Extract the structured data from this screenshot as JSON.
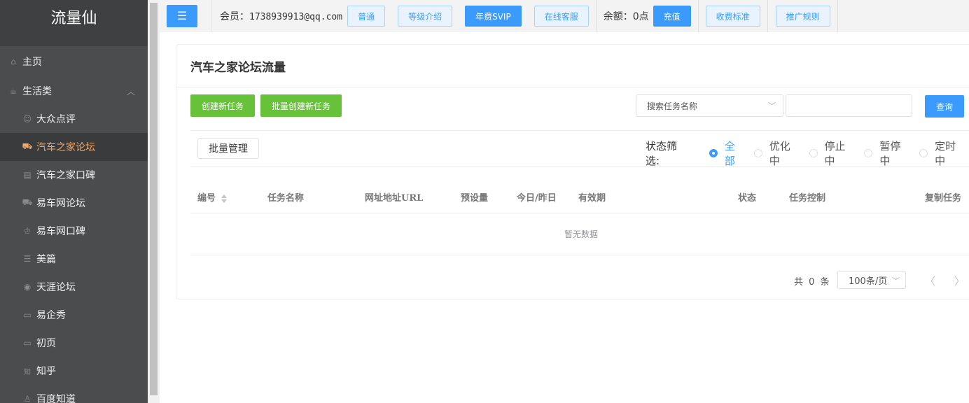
{
  "sidebar": {
    "brand": "流量仙",
    "items": [
      {
        "label": "主页",
        "icon": "home-icon",
        "glyph": "⌂",
        "level": "top"
      },
      {
        "label": "生活类",
        "icon": "cup-icon",
        "glyph": "☕",
        "level": "top",
        "expanded": true
      },
      {
        "label": "大众点评",
        "icon": "person-icon",
        "glyph": "☺",
        "level": "sub"
      },
      {
        "label": "汽车之家论坛",
        "icon": "car-icon",
        "glyph": "⛟",
        "level": "sub",
        "active": true
      },
      {
        "label": "汽车之家口碑",
        "icon": "document-icon",
        "glyph": "▤",
        "level": "sub"
      },
      {
        "label": "易车网论坛",
        "icon": "car-icon",
        "glyph": "⛟",
        "level": "sub"
      },
      {
        "label": "易车网口碑",
        "icon": "crown-icon",
        "glyph": "♔",
        "level": "sub"
      },
      {
        "label": "美篇",
        "icon": "list-icon",
        "glyph": "☰",
        "level": "sub"
      },
      {
        "label": "天涯论坛",
        "icon": "globe-icon",
        "glyph": "◉",
        "level": "sub"
      },
      {
        "label": "易企秀",
        "icon": "glasses-icon",
        "glyph": "▭",
        "level": "sub"
      },
      {
        "label": "初页",
        "icon": "glasses-icon",
        "glyph": "▭",
        "level": "sub"
      },
      {
        "label": "知乎",
        "icon": "zhihu-icon",
        "glyph": "知",
        "level": "sub"
      },
      {
        "label": "百度知道",
        "icon": "person-icon",
        "glyph": "♙",
        "level": "sub"
      }
    ]
  },
  "topbar": {
    "menu_toggle": "☰",
    "member_label": "会员：",
    "member_email": "1738939913@qq.com",
    "btn_normal": "普通",
    "btn_level": "等级介绍",
    "btn_svip": "年费SVIP",
    "btn_service": "在线客服",
    "balance_label": "余额：",
    "balance_value": "0点",
    "btn_recharge": "充值",
    "btn_fees": "收费标准",
    "btn_promo": "推广规则"
  },
  "main": {
    "title": "汽车之家论坛流量",
    "btn_create": "创建新任务",
    "btn_batch_create": "批量创建新任务",
    "search_placeholder": "搜索任务名称",
    "search_value": "",
    "btn_query": "查询",
    "btn_batch_manage": "批量管理",
    "status_label": "状态筛选:",
    "statuses": [
      "全部",
      "优化中",
      "停止中",
      "暂停中",
      "定时中"
    ],
    "status_selected": "全部",
    "columns": [
      "编号",
      "任务名称",
      "网址地址URL",
      "预设量",
      "今日/昨日",
      "有效期",
      "状态",
      "任务控制",
      "复制任务"
    ],
    "empty_text": "暂无数据",
    "pager": {
      "total_prefix": "共",
      "total": 0,
      "total_suffix": "条",
      "page_size": "100条/页"
    }
  },
  "colors": {
    "primary": "#3a9bfc",
    "success": "#67c23a",
    "sidebar_bg": "#4b4c4e",
    "active_text": "#f0a868"
  }
}
